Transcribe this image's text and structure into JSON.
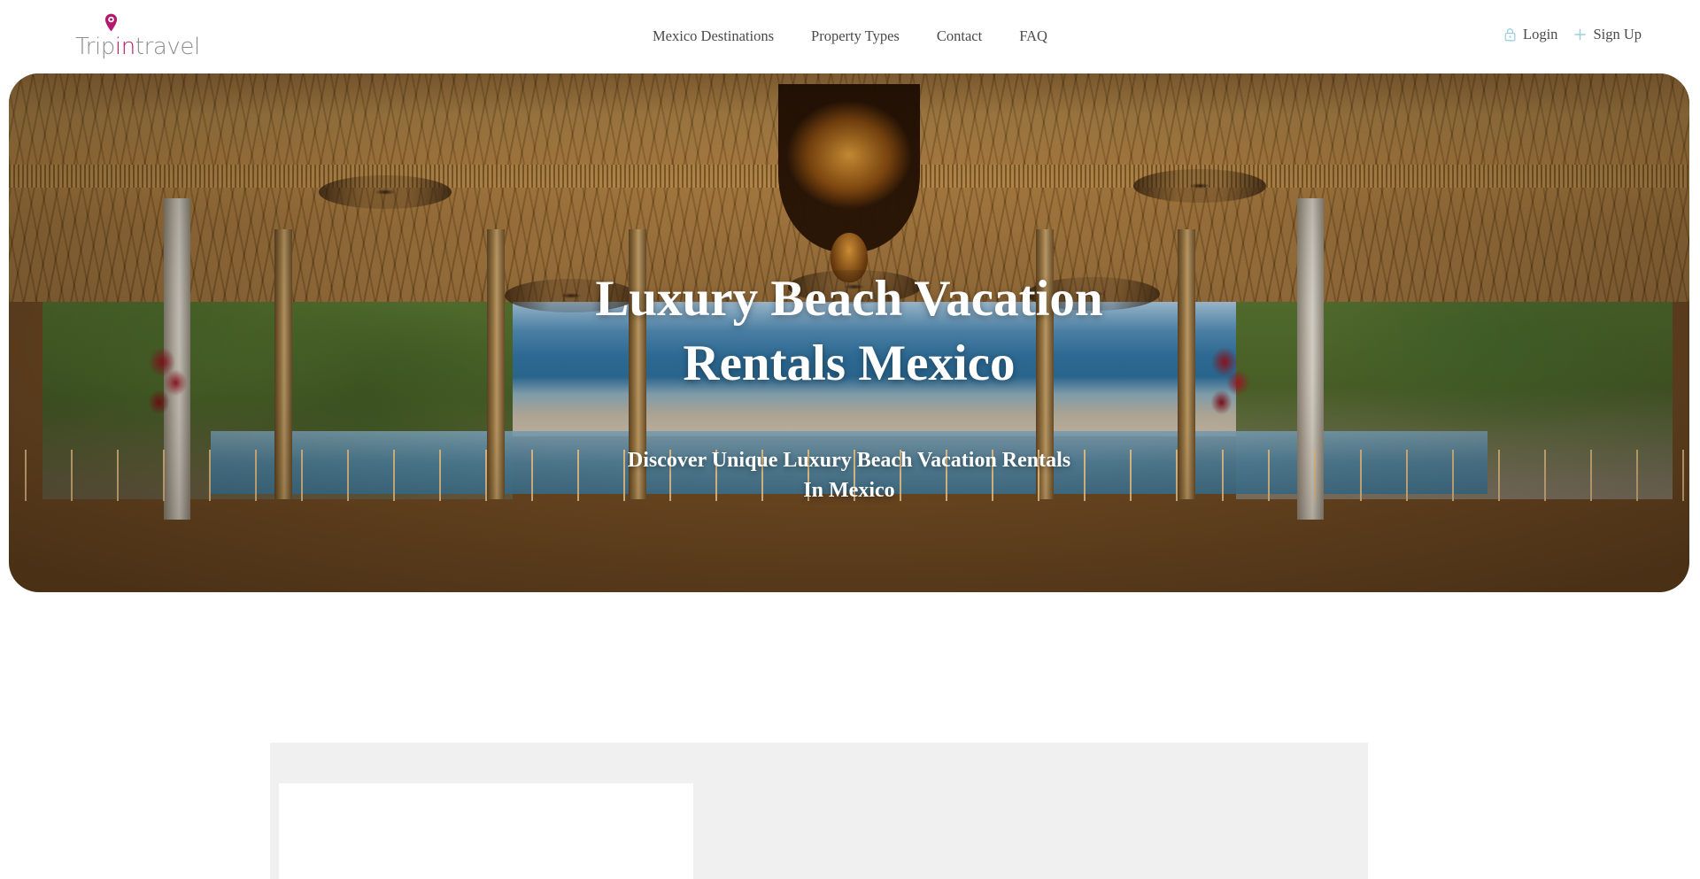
{
  "brand": {
    "name_part1": "Trip",
    "name_part2": "in",
    "name_part3": "travel",
    "accent_color": "#b4186a",
    "text_color": "#8d8d8d",
    "pin_icon": "map-pin-icon"
  },
  "nav": {
    "items": [
      {
        "label": "Mexico Destinations"
      },
      {
        "label": "Property Types"
      },
      {
        "label": "Contact"
      },
      {
        "label": "FAQ"
      }
    ]
  },
  "auth": {
    "login": {
      "label": "Login",
      "icon": "lock-icon"
    },
    "signup": {
      "label": "Sign Up",
      "icon": "plus-icon"
    },
    "icon_color": "#9ecfe0"
  },
  "hero": {
    "title_line1": "Luxury Beach Vacation",
    "title_line2": "Rentals Mexico",
    "subtitle_line1": "Discover Unique Luxury Beach Vacation Rentals",
    "subtitle_line2": "In Mexico",
    "image_alt": "Luxury beachfront palapa lounge with ocean view in Mexico"
  },
  "below": {
    "panel_background": "#f0f0f0",
    "card_background": "#ffffff"
  }
}
